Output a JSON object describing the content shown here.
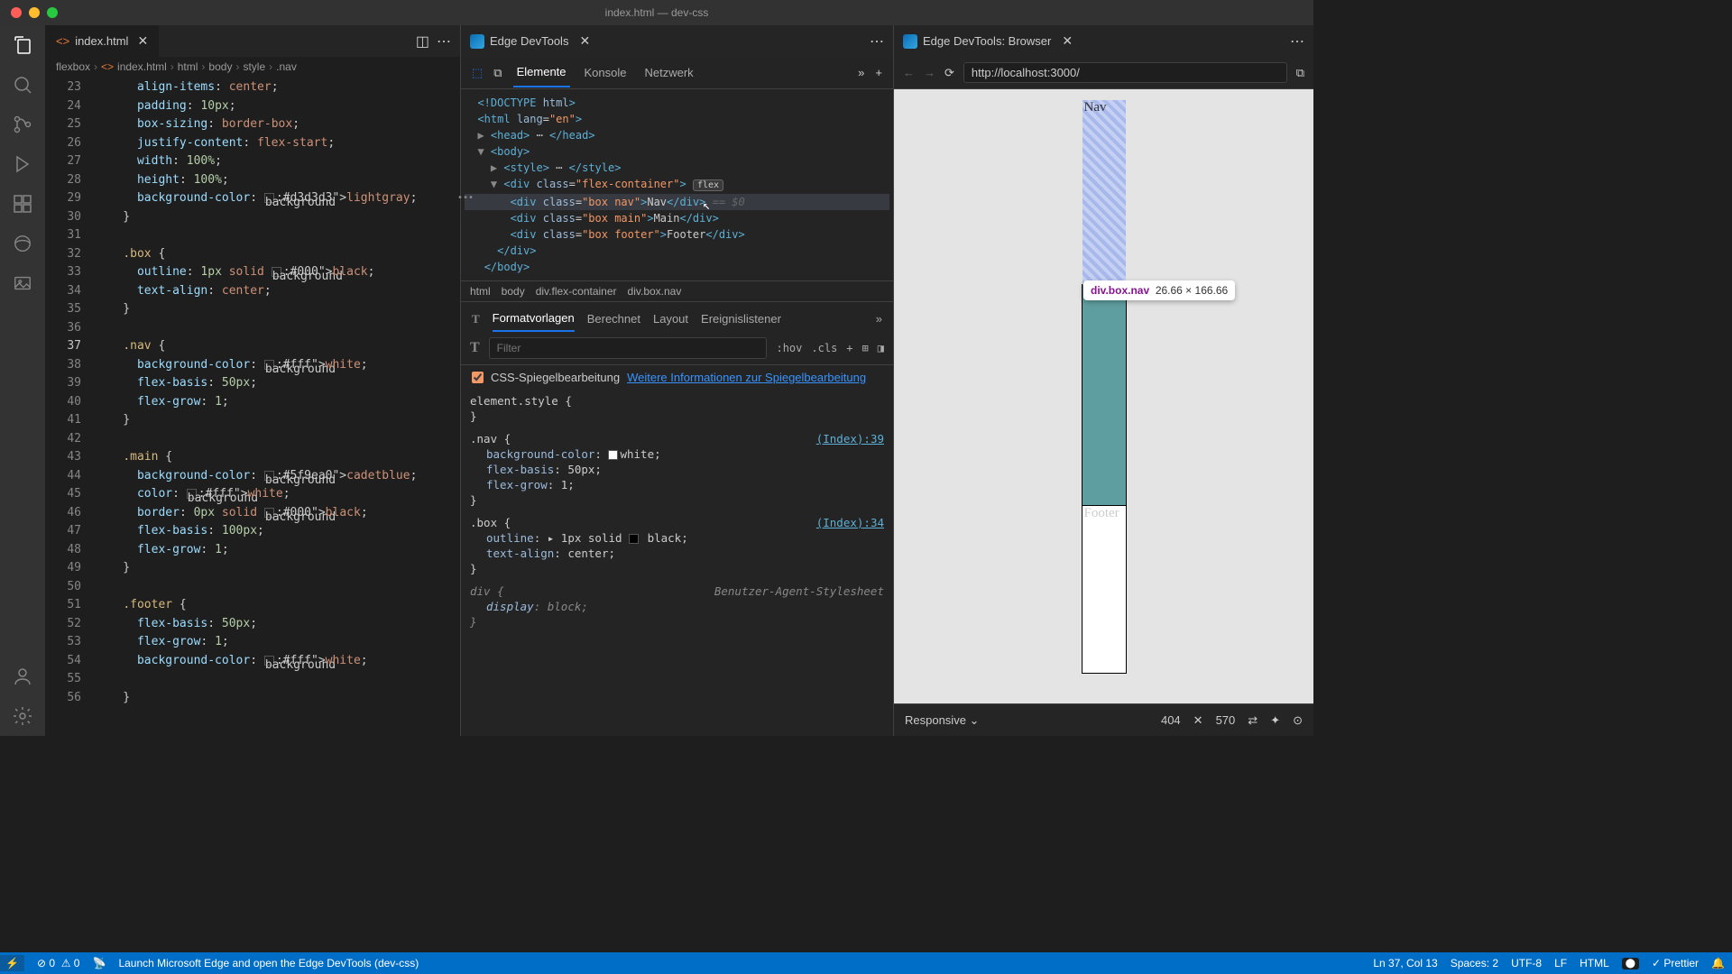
{
  "window": {
    "title": "index.html — dev-css"
  },
  "editor": {
    "tab": {
      "filename": "index.html"
    },
    "breadcrumbs": [
      "flexbox",
      "index.html",
      "html",
      "body",
      "style",
      ".nav"
    ],
    "gutter_start": 23,
    "current_line": 37,
    "status": {
      "launch": "Launch Microsoft Edge and open the Edge DevTools (dev-css)",
      "errors": "0",
      "warnings": "0",
      "pos": "Ln 37, Col 13",
      "spaces": "Spaces: 2",
      "enc": "UTF-8",
      "eol": "LF",
      "lang": "HTML",
      "prettier": "Prettier"
    }
  },
  "devtools": {
    "tab_title": "Edge DevTools",
    "tabs": {
      "elements": "Elemente",
      "console": "Konsole",
      "network": "Netzwerk"
    },
    "path": [
      "html",
      "body",
      "div.flex-container",
      "div.box.nav"
    ],
    "styles_tabs": {
      "styles": "Formatvorlagen",
      "computed": "Berechnet",
      "layout": "Layout",
      "listeners": "Ereignislistener"
    },
    "filter_placeholder": "Filter",
    "hov": ":hov",
    "cls": ".cls",
    "mirror": {
      "label": "CSS-Spiegelbearbeitung",
      "link": "Weitere Informationen zur Spiegelbearbeitung"
    },
    "rules": {
      "elstyle": "element.style {",
      "nav_src": "(Index):39",
      "box_src": "(Index):34",
      "ua": "Benutzer-Agent-Stylesheet"
    }
  },
  "browser": {
    "tab_title": "Edge DevTools: Browser",
    "url": "http://localhost:3000/",
    "tooltip_label": "div.box.nav",
    "tooltip_dims": "26.66 × 166.66",
    "nav_text": "Nav",
    "footer_text": "Footer",
    "responsive": {
      "label": "Responsive",
      "w": "404",
      "h": "570"
    }
  },
  "code_lines": [
    "      align-items: center;",
    "      padding: 10px;",
    "      box-sizing: border-box;",
    "      justify-content: flex-start;",
    "      width: 100%;",
    "      height: 100%;",
    "      background-color: ◧lightgray;",
    "    }",
    "",
    "    .box {",
    "      outline: 1px solid ◧black;",
    "      text-align: center;",
    "    }",
    "",
    "    .nav {",
    "      background-color: ◧white;",
    "      flex-basis: 50px;",
    "      flex-grow: 1;",
    "    }",
    "",
    "    .main {",
    "      background-color: ◧cadetblue;",
    "      color: ◧white;",
    "      border: 0px solid ◧black;",
    "      flex-basis: 100px;",
    "      flex-grow: 1;",
    "    }",
    "",
    "    .footer {",
    "      flex-basis: 50px;",
    "      flex-grow: 1;",
    "      background-color: ◧white;",
    "",
    "    }"
  ]
}
